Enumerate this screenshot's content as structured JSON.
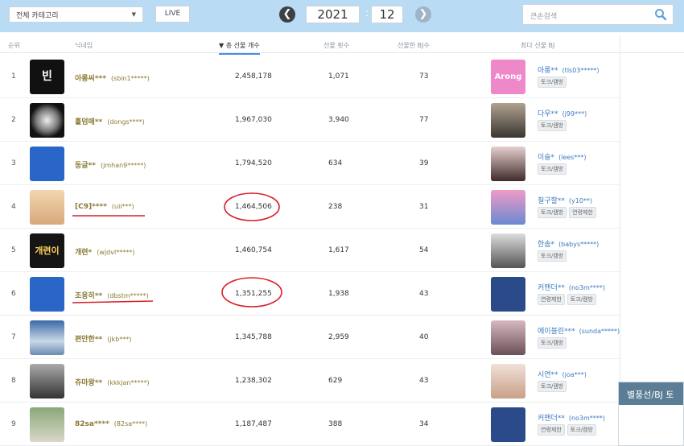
{
  "toolbar": {
    "category": "전체 카테고리",
    "live": "LIVE",
    "year": "2021",
    "month": "12",
    "search_placeholder": "큰손검색"
  },
  "columns": {
    "rank": "순위",
    "nickname": "닉네임",
    "total": "▼ 총 선물 개수",
    "times": "선물 횟수",
    "bj_count": "선물한 BJ수",
    "top_bj": "최다 선물 BJ"
  },
  "rows": [
    {
      "rank": "1",
      "nick": "아롱씨***",
      "uid": "(sbin1*****)",
      "total": "2,458,178",
      "times": "1,071",
      "bjs": "73",
      "bj": "아롱**",
      "bj_uid": "(tls03*****)",
      "tags": [
        "토크/캠방"
      ],
      "thumb_text": "빈",
      "bj_thumb_text": "Arong"
    },
    {
      "rank": "2",
      "nick": "홀덤매**",
      "uid": "(dongs****)",
      "total": "1,967,030",
      "times": "3,940",
      "bjs": "77",
      "bj": "다우**",
      "bj_uid": "(j99***)",
      "tags": [
        "토크/캠방"
      ],
      "thumb_text": "",
      "bj_thumb_text": ""
    },
    {
      "rank": "3",
      "nick": "동글**",
      "uid": "(jmhan9*****)",
      "total": "1,794,520",
      "times": "634",
      "bjs": "39",
      "bj": "이슬*",
      "bj_uid": "(lees***)",
      "tags": [
        "토크/캠방"
      ],
      "thumb_text": "",
      "bj_thumb_text": ""
    },
    {
      "rank": "4",
      "nick": "[C9]****",
      "uid": "(uii***)",
      "total": "1,464,506",
      "times": "238",
      "bjs": "31",
      "bj": "칠구할**",
      "bj_uid": "(y10**)",
      "tags": [
        "토크/캠방",
        "연령제한"
      ],
      "thumb_text": "",
      "bj_thumb_text": ""
    },
    {
      "rank": "5",
      "nick": "개련*",
      "uid": "(wjdvl*****)",
      "total": "1,460,754",
      "times": "1,617",
      "bjs": "54",
      "bj": "한솜*",
      "bj_uid": "(babys*****)",
      "tags": [
        "토크/캠방"
      ],
      "thumb_text": "개련이",
      "bj_thumb_text": ""
    },
    {
      "rank": "6",
      "nick": "조용히**",
      "uid": "(dbstm*****)",
      "total": "1,351,255",
      "times": "1,938",
      "bjs": "43",
      "bj": "커맨더**",
      "bj_uid": "(no3m****)",
      "tags": [
        "연령제한",
        "토크/캠방"
      ],
      "thumb_text": "",
      "bj_thumb_text": ""
    },
    {
      "rank": "7",
      "nick": "편안한**",
      "uid": "(jkb***)",
      "total": "1,345,788",
      "times": "2,959",
      "bjs": "40",
      "bj": "에이블린***",
      "bj_uid": "(sunda*****)",
      "tags": [
        "토크/캠방"
      ],
      "thumb_text": "",
      "bj_thumb_text": ""
    },
    {
      "rank": "8",
      "nick": "쥬마왕**",
      "uid": "(kkkjan*****)",
      "total": "1,238,302",
      "times": "629",
      "bjs": "43",
      "bj": "시연**",
      "bj_uid": "(joa***)",
      "tags": [
        "토크/캠방"
      ],
      "thumb_text": "",
      "bj_thumb_text": ""
    },
    {
      "rank": "9",
      "nick": "82sa****",
      "uid": "(82sa****)",
      "total": "1,187,487",
      "times": "388",
      "bjs": "34",
      "bj": "커맨더**",
      "bj_uid": "(no3m****)",
      "tags": [
        "연령제한",
        "토크/캠방"
      ],
      "thumb_text": "",
      "bj_thumb_text": ""
    }
  ],
  "popup": {
    "title": "별풍선/BJ 토"
  }
}
